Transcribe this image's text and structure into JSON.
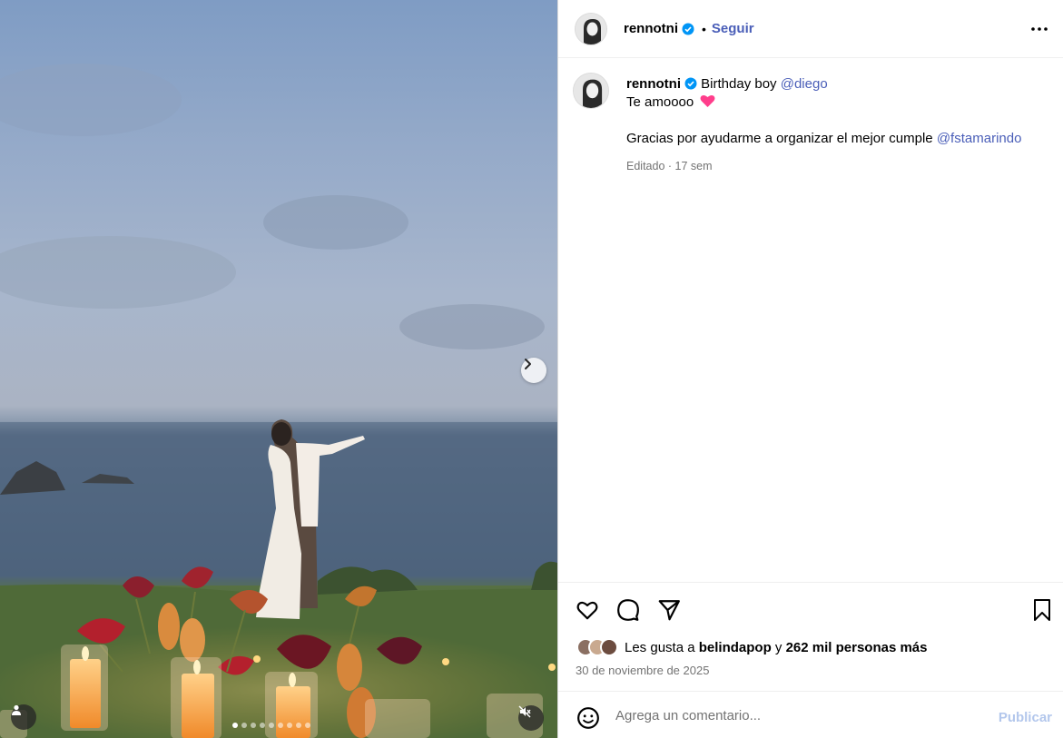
{
  "post": {
    "author": "rennotni",
    "verified": true,
    "separator": "•",
    "follow_label": "Seguir",
    "more_icon": "more-horizontal-icon"
  },
  "caption": {
    "author": "rennotni",
    "text_prefix": "Birthday boy",
    "mention_1": "@diego",
    "line_2": "Te amoooo",
    "line_2_emoji": "pink-heart-emoji",
    "line_3": "Gracias por ayudarme a organizar el mejor cumple",
    "mention_2": "@fstamarindo",
    "edited_label": "Editado",
    "dot": "·",
    "age": "17 sem"
  },
  "media": {
    "carousel_total": 9,
    "carousel_active_index": 0,
    "next_icon": "chevron-right-icon",
    "tag_icon": "user-tag-icon",
    "mute_icon": "volume-muted-icon"
  },
  "actions": {
    "like_icon": "heart-icon",
    "comment_icon": "comment-icon",
    "share_icon": "share-icon",
    "save_icon": "bookmark-icon"
  },
  "likes": {
    "prefix": "Les gusta a",
    "user": "belindapop",
    "conjunction": "y",
    "others": "262 mil personas más"
  },
  "date": "30 de noviembre de 2025",
  "comment": {
    "emoji_icon": "emoji-icon",
    "placeholder": "Agrega un comentario...",
    "publish_label": "Publicar"
  },
  "colors": {
    "link": "#4a5eb8",
    "verified": "#0095f6",
    "muted": "#737373",
    "publish_disabled": "#b3c7ec",
    "heart": "#ff3d8b"
  }
}
